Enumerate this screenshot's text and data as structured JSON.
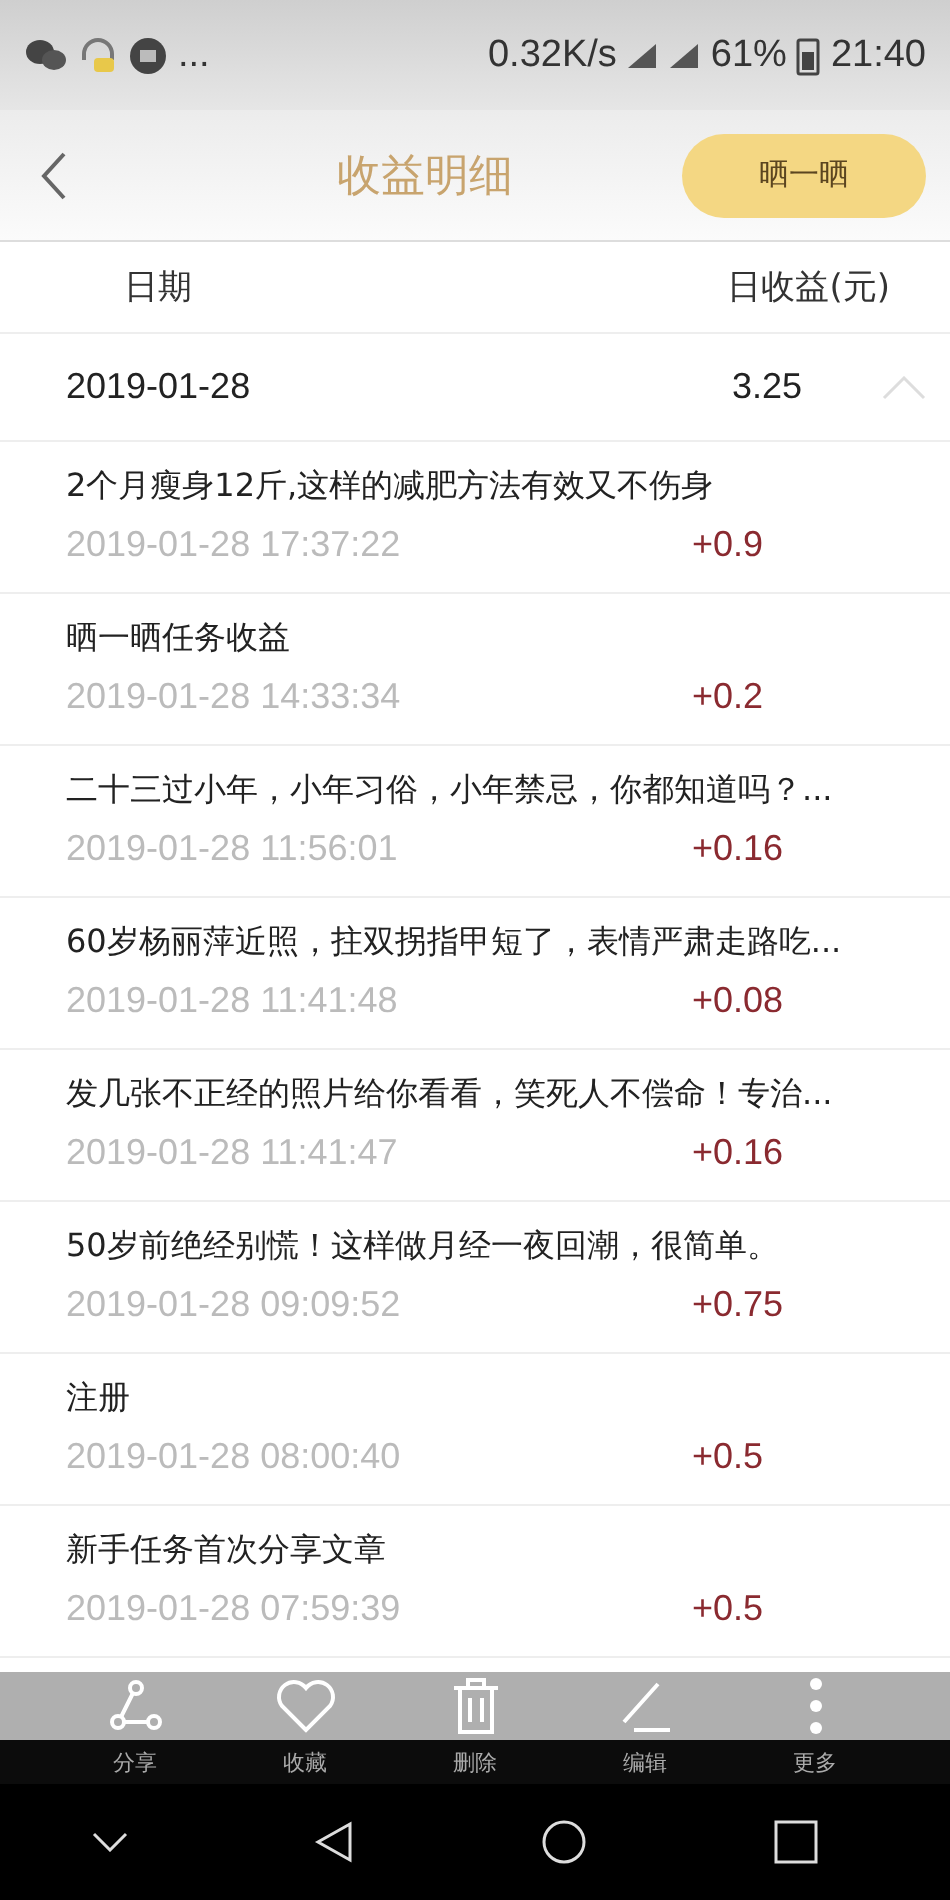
{
  "status_bar": {
    "more": "...",
    "speed": "0.32K/s",
    "battery": "61%",
    "time": "21:40"
  },
  "header": {
    "title": "收益明细",
    "share_button": "晒一晒"
  },
  "columns": [
    "日期",
    "日收益(元)"
  ],
  "group": {
    "date": "2019-01-28",
    "total": "3.25",
    "expanded": true
  },
  "rows": [
    {
      "title": "2个月瘦身12斤,这样的减肥方法有效又不伤身",
      "time": "2019-01-28 17:37:22",
      "amount": "+0.9"
    },
    {
      "title": "晒一晒任务收益",
      "time": "2019-01-28 14:33:34",
      "amount": "+0.2"
    },
    {
      "title": "二十三过小年，小年习俗，小年禁忌，你都知道吗？...",
      "time": "2019-01-28 11:56:01",
      "amount": "+0.16"
    },
    {
      "title": "60岁杨丽萍近照，拄双拐指甲短了，表情严肃走路吃...",
      "time": "2019-01-28 11:41:48",
      "amount": "+0.08"
    },
    {
      "title": "发几张不正经的照片给你看看，笑死人不偿命！专治...",
      "time": "2019-01-28 11:41:47",
      "amount": "+0.16"
    },
    {
      "title": "50岁前绝经别慌！这样做月经一夜回潮，很简单。",
      "time": "2019-01-28 09:09:52",
      "amount": "+0.75"
    },
    {
      "title": "注册",
      "time": "2019-01-28 08:00:40",
      "amount": "+0.5"
    },
    {
      "title": "新手任务首次分享文章",
      "time": "2019-01-28 07:59:39",
      "amount": "+0.5"
    }
  ],
  "toolbar": [
    {
      "kind": "share",
      "label": "分享"
    },
    {
      "kind": "favorite",
      "label": "收藏"
    },
    {
      "kind": "delete",
      "label": "删除"
    },
    {
      "kind": "edit",
      "label": "编辑"
    },
    {
      "kind": "more",
      "label": "更多"
    }
  ]
}
